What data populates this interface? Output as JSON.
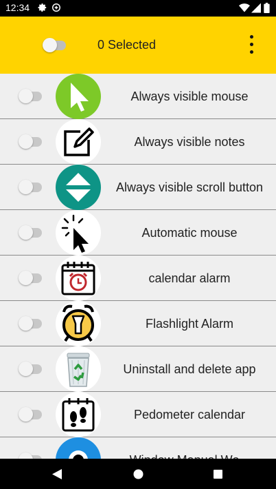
{
  "status_bar": {
    "time": "12:34"
  },
  "header": {
    "selected_text": "0 Selected"
  },
  "apps": [
    {
      "label": "Always visible mouse",
      "icon": "mouse-pointer-icon",
      "selected": false
    },
    {
      "label": "Always visible notes",
      "icon": "note-edit-icon",
      "selected": false
    },
    {
      "label": "Always visible scroll button",
      "icon": "scroll-arrows-icon",
      "selected": false
    },
    {
      "label": "Automatic mouse",
      "icon": "auto-click-icon",
      "selected": false
    },
    {
      "label": "calendar alarm",
      "icon": "calendar-alarm-icon",
      "selected": false
    },
    {
      "label": "Flashlight Alarm",
      "icon": "flashlight-alarm-icon",
      "selected": false
    },
    {
      "label": "Uninstall and delete app",
      "icon": "recycle-bin-icon",
      "selected": false
    },
    {
      "label": "Pedometer calendar",
      "icon": "pedometer-calendar-icon",
      "selected": false
    },
    {
      "label": "Window Manual Wo...",
      "icon": "window-icon",
      "selected": false
    }
  ],
  "colors": {
    "header": "#ffd300",
    "mouse_icon_bg": "#7dc928",
    "scroll_icon_bg": "#0e9486",
    "window_icon_bg": "#1e8fe1"
  }
}
